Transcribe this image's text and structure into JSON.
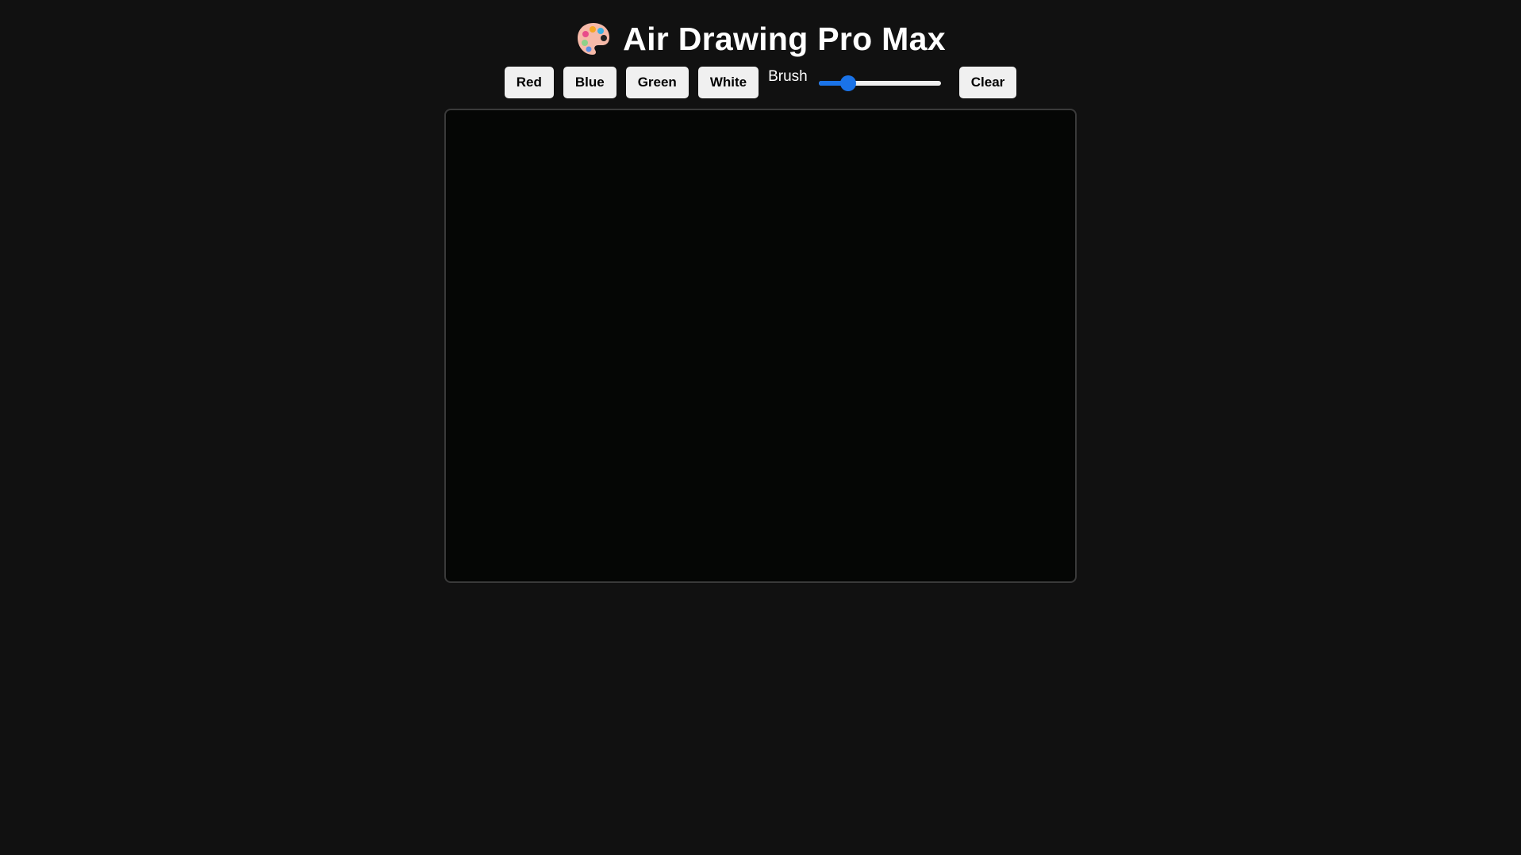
{
  "header": {
    "title": "Air Drawing Pro Max",
    "icon": "palette-icon"
  },
  "toolbar": {
    "colors": [
      {
        "label": "Red",
        "value": "#ff0000"
      },
      {
        "label": "Blue",
        "value": "#0000ff"
      },
      {
        "label": "Green",
        "value": "#00ff00"
      },
      {
        "label": "White",
        "value": "#ffffff"
      }
    ],
    "brush_label": "Brush",
    "brush_size_fraction": 0.2,
    "clear_label": "Clear"
  },
  "colors": {
    "background": "#111111",
    "canvas": "#050605",
    "accent": "#1a73e8",
    "button_bg": "#f0f0f0"
  }
}
